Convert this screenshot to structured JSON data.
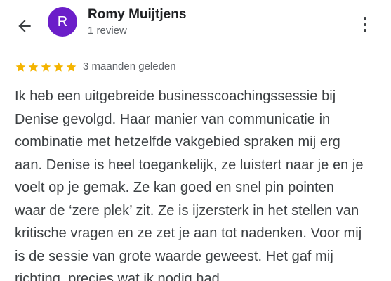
{
  "header": {
    "back_icon": "arrow-left-icon",
    "avatar_letter": "R",
    "avatar_color": "#6B1EC9",
    "user_name": "Romy Muijtjens",
    "review_count": "1 review",
    "more_icon": "more-vert-icon"
  },
  "review": {
    "rating": 5,
    "rating_max": 5,
    "star_color": "#F4B400",
    "star_icon": "star-icon",
    "time": "3 maanden geleden",
    "text": "Ik heb een uitgebreide businesscoachingssessie bij\nDenise gevolgd. Haar manier van communicatie in\ncombinatie met hetzelfde vakgebied spraken mij erg\naan. Denise is heel toegankelijk, ze luistert naar je en je\nvoelt op je gemak. Ze kan goed en snel pin pointen\nwaar de ‘zere plek’ zit. Ze is ijzersterk in het stellen van\nkritische vragen en ze zet je aan tot nadenken. Voor mij\nis de sessie van grote waarde geweest. Het gaf mij\nrichting, precies wat ik nodig had."
  }
}
